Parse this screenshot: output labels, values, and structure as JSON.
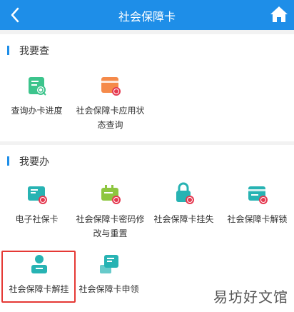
{
  "nav": {
    "title": "社会保障卡"
  },
  "sections": [
    {
      "title": "我要查",
      "items": [
        {
          "label_lines": [
            "查询办卡进度"
          ],
          "icon": "progress-search-icon"
        },
        {
          "label_lines": [
            "社会保障卡应用状",
            "态查询"
          ],
          "icon": "card-status-icon"
        }
      ]
    },
    {
      "title": "我要办",
      "items": [
        {
          "label_lines": [
            "电子社保卡"
          ],
          "icon": "e-card-icon"
        },
        {
          "label_lines": [
            "社会保障卡密码修",
            "改与重置"
          ],
          "icon": "password-reset-icon"
        },
        {
          "label_lines": [
            "社会保障卡挂失"
          ],
          "icon": "report-loss-icon"
        },
        {
          "label_lines": [
            "社会保障卡解锁"
          ],
          "icon": "unlock-icon"
        },
        {
          "label_lines": [
            "社会保障卡解挂"
          ],
          "icon": "cancel-loss-report-icon"
        },
        {
          "label_lines": [
            "社会保障卡申领"
          ],
          "icon": "apply-card-icon"
        }
      ]
    }
  ],
  "watermark": "易坊好文馆",
  "colors": {
    "nav": "#1e8ee8",
    "accent_blue": "#1e8ee8",
    "green": "#3cc48c",
    "orange": "#f58a4a",
    "teal": "#27b3b3",
    "red_badge": "#e53950",
    "highlight": "#e53935"
  }
}
